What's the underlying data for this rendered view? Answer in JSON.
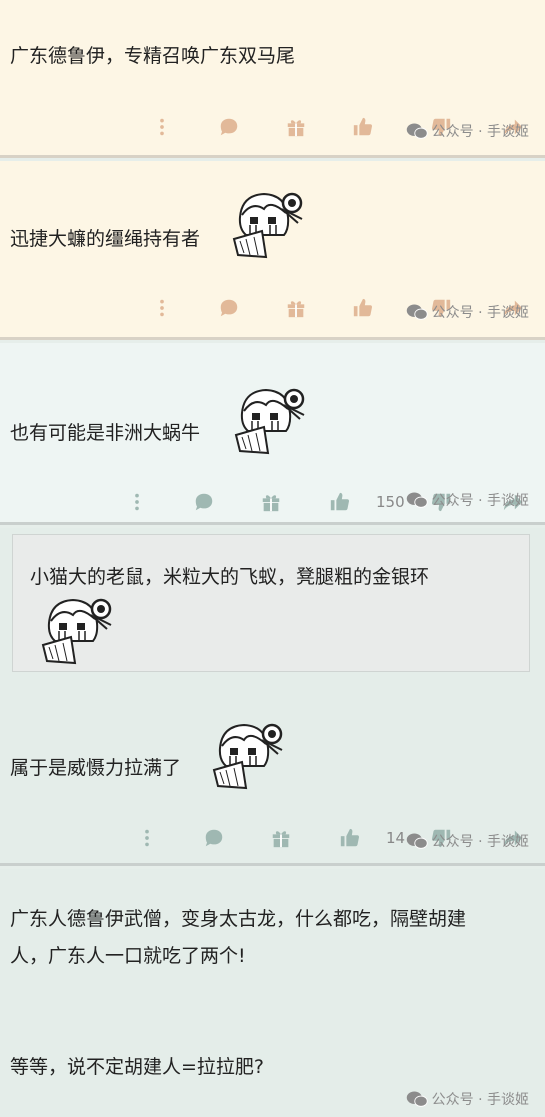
{
  "watermark": "公众号 · 手谈姬",
  "colors": {
    "warm_icon": "#e2b999",
    "cool_icon": "#9fb8b2",
    "warm_bg": "#fdf6e5",
    "cool_bg": "#e4ede9"
  },
  "posts": [
    {
      "text": "广东德鲁伊，专精召唤广东双马尾"
    },
    {
      "text": "迅捷大蠊的缰绳持有者"
    },
    {
      "text": "也有可能是非洲大蜗牛",
      "like_count": "150"
    },
    {
      "quote": "小猫大的老鼠，米粒大的飞蚁，凳腿粗的金银环",
      "text": "属于是威慑力拉满了",
      "like_count": "14"
    },
    {
      "line1": "广东人德鲁伊武僧，变身太古龙，什么都吃，隔壁胡建",
      "line2": "人，广东人一口就吃了两个!",
      "line3": "等等，说不定胡建人=拉拉肥?"
    }
  ],
  "icons": [
    "more-icon",
    "comment-icon",
    "gift-icon",
    "like-icon",
    "dislike-icon",
    "share-icon",
    "wechat-icon"
  ]
}
